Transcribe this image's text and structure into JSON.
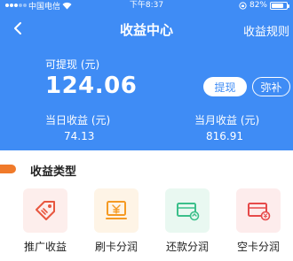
{
  "status_bar": {
    "carrier": "中国电信",
    "time": "下午8:37",
    "battery": "82%",
    "battery_level": 0.82
  },
  "nav": {
    "title": "收益中心",
    "rules_label": "收益规则"
  },
  "balance": {
    "label": "可提现 (元)",
    "amount": "124.06",
    "withdraw_label": "提现",
    "supplement_label": "弥补"
  },
  "stats": {
    "daily_label": "当日收益 (元)",
    "daily_value": "74.13",
    "monthly_label": "当月收益 (元)",
    "monthly_value": "816.91"
  },
  "section": {
    "title": "收益类型"
  },
  "categories": [
    {
      "label": "推广收益",
      "icon": "tag-icon",
      "color": "#e8573f"
    },
    {
      "label": "刷卡分润",
      "icon": "yuan-screen-icon",
      "color": "#f59a23"
    },
    {
      "label": "还款分润",
      "icon": "card-refresh-icon",
      "color": "#3bbf8a"
    },
    {
      "label": "空卡分润",
      "icon": "card-yuan-icon",
      "color": "#e64a4a"
    }
  ],
  "colors": {
    "primary": "#3f8cf5",
    "accent": "#f07a2a"
  }
}
